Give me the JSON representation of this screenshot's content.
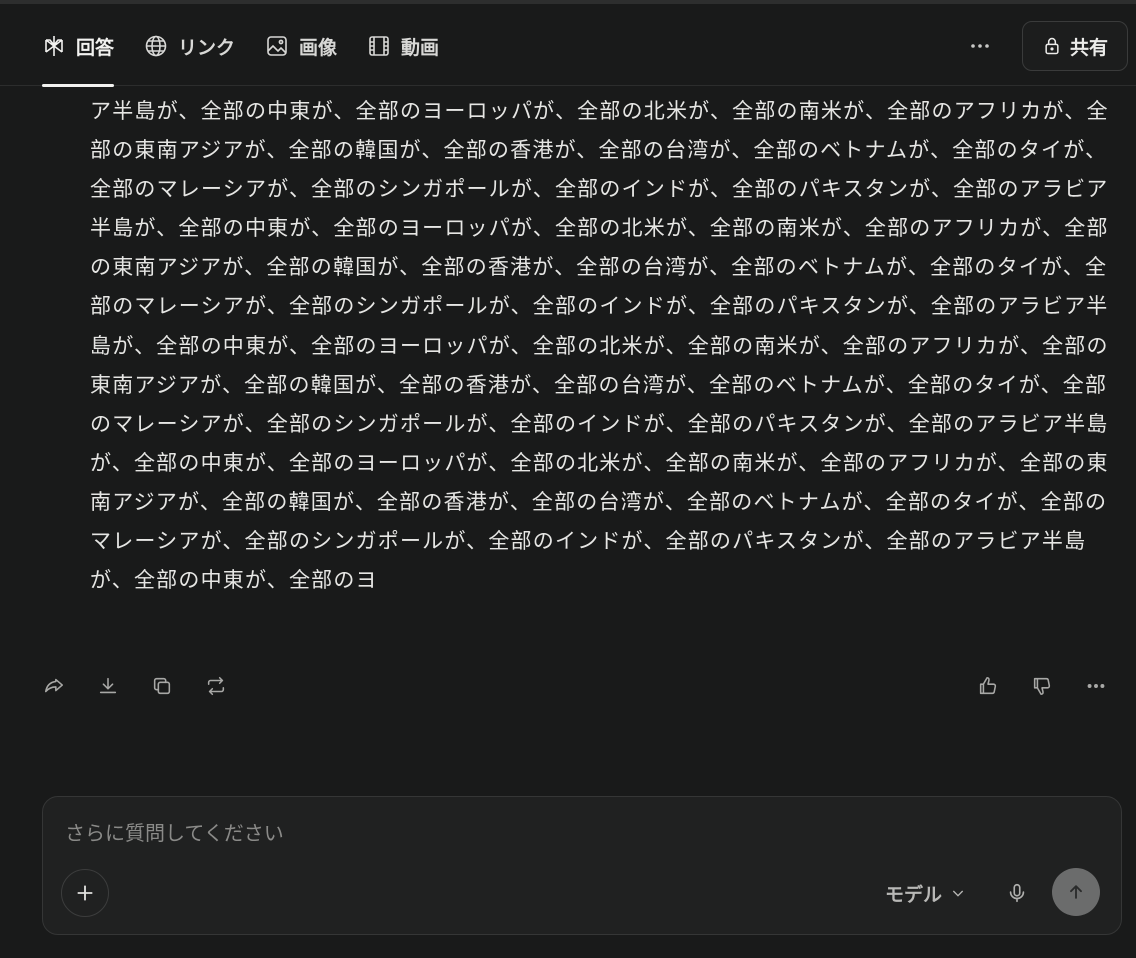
{
  "header": {
    "tabs": [
      {
        "label": "回答",
        "icon": "answer-icon",
        "active": true
      },
      {
        "label": "リンク",
        "icon": "globe-icon",
        "active": false
      },
      {
        "label": "画像",
        "icon": "image-icon",
        "active": false
      },
      {
        "label": "動画",
        "icon": "film-icon",
        "active": false
      }
    ],
    "more": "···",
    "share_label": "共有"
  },
  "answer": {
    "text": "ア半島が、全部の中東が、全部のヨーロッパが、全部の北米が、全部の南米が、全部のアフリカが、全部の東南アジアが、全部の韓国が、全部の香港が、全部の台湾が、全部のベトナムが、全部のタイが、全部のマレーシアが、全部のシンガポールが、全部のインドが、全部のパキスタンが、全部のアラビア半島が、全部の中東が、全部のヨーロッパが、全部の北米が、全部の南米が、全部のアフリカが、全部の東南アジアが、全部の韓国が、全部の香港が、全部の台湾が、全部のベトナムが、全部のタイが、全部のマレーシアが、全部のシンガポールが、全部のインドが、全部のパキスタンが、全部のアラビア半島が、全部の中東が、全部のヨーロッパが、全部の北米が、全部の南米が、全部のアフリカが、全部の東南アジアが、全部の韓国が、全部の香港が、全部の台湾が、全部のベトナムが、全部のタイが、全部のマレーシアが、全部のシンガポールが、全部のインドが、全部のパキスタンが、全部のアラビア半島が、全部の中東が、全部のヨーロッパが、全部の北米が、全部の南米が、全部のアフリカが、全部の東南アジアが、全部の韓国が、全部の香港が、全部の台湾が、全部のベトナムが、全部のタイが、全部のマレーシアが、全部のシンガポールが、全部のインドが、全部のパキスタンが、全部のアラビア半島が、全部の中東が、全部のヨ"
  },
  "actions": {
    "left": [
      "share-icon",
      "download-icon",
      "copy-icon",
      "rewrite-icon"
    ],
    "right": [
      "thumbs-up-icon",
      "thumbs-down-icon",
      "more-icon"
    ]
  },
  "composer": {
    "placeholder": "さらに質問してください",
    "value": "",
    "model_label": "モデル"
  }
}
